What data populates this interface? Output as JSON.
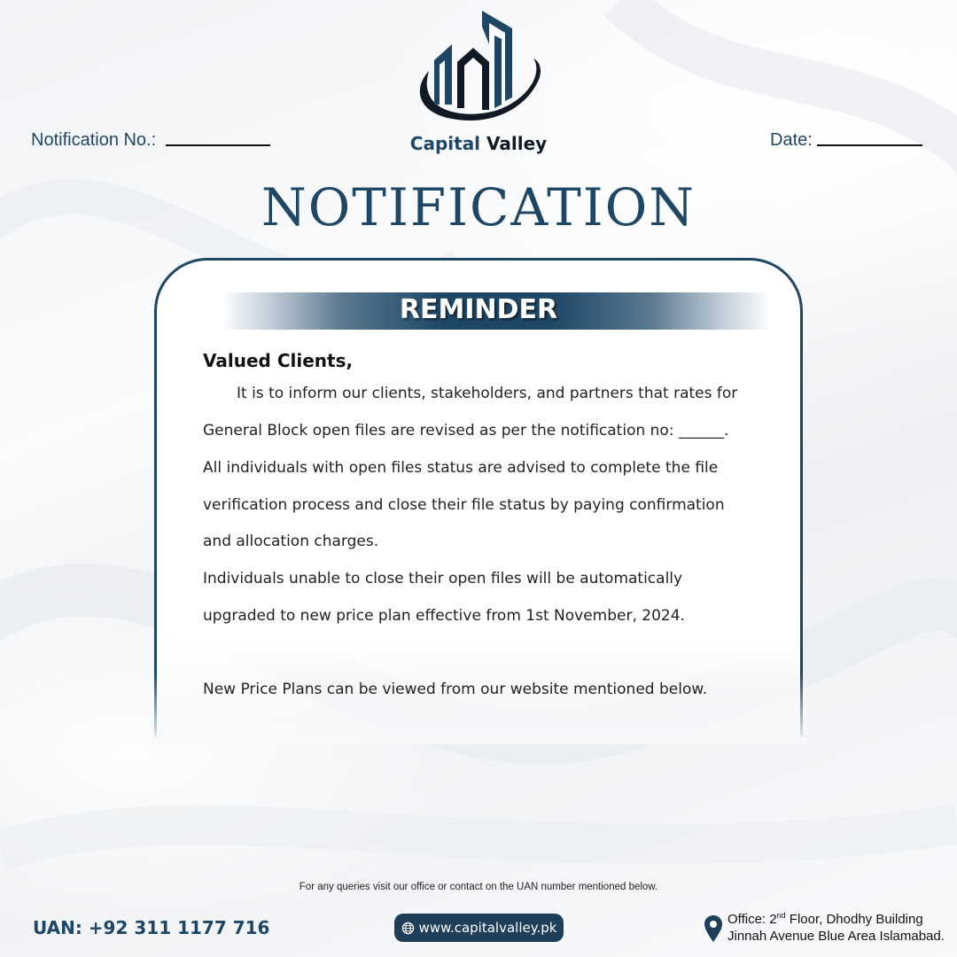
{
  "brand": {
    "word1": "Capital",
    "word2": "Valley"
  },
  "header": {
    "notification_no_label": "Notification No.:",
    "date_label": "Date:",
    "title": "NOTIFICATION"
  },
  "card": {
    "ribbon": "REMINDER",
    "greeting": "Valued Clients,",
    "lines": [
      "It is to inform our clients, stakeholders, and partners that rates for",
      "General Block open files are revised as per the notification no: ______.",
      "All individuals with open files status are advised to complete the file",
      "verification process and close their file status by paying confirmation",
      "and allocation charges.",
      "Individuals unable to close their open files will be automatically",
      "upgraded to new price plan effective from 1st November, 2024.",
      "New Price Plans can be viewed from our website mentioned below."
    ]
  },
  "footer": {
    "note": "For any queries visit our office or contact on the UAN number mentioned below.",
    "uan": "UAN: +92 311 1177 716",
    "website": "www.capitalvalley.pk",
    "office_line1_prefix": "Office: 2",
    "office_line1_sup": "nd",
    "office_line1_suffix": " Floor, Dhodhy Building",
    "office_line2": "Jinnah Avenue Blue Area Islamabad."
  },
  "colors": {
    "primary": "#1e4766",
    "dark": "#111a24",
    "pill": "#1e3e5a"
  },
  "icons": [
    "building-logo-icon",
    "globe-icon",
    "location-pin-icon"
  ]
}
